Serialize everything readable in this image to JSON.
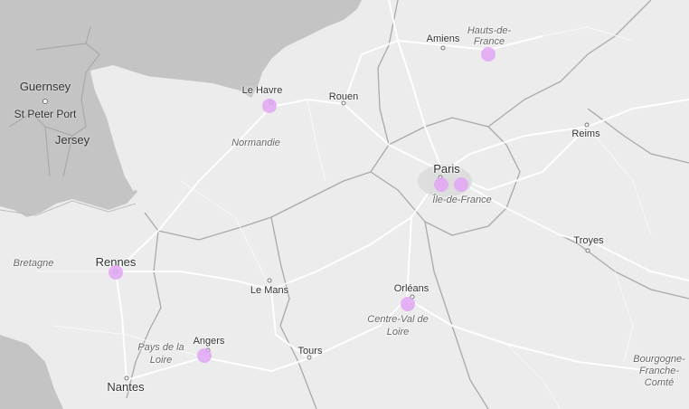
{
  "map": {
    "colors": {
      "sea": "#c4c4c4",
      "land": "#ececec",
      "road": "#ffffff",
      "border": "#a9a9a9",
      "marker": "#e2a6f5"
    },
    "islands": [
      "Guernsey",
      "St Peter Port",
      "Jersey"
    ],
    "cities": {
      "amiens": "Amiens",
      "le_havre": "Le Havre",
      "rouen": "Rouen",
      "paris": "Paris",
      "reims": "Reims",
      "troyes": "Troyes",
      "rennes": "Rennes",
      "le_mans": "Le Mans",
      "orleans": "Orléans",
      "angers": "Angers",
      "tours": "Tours",
      "nantes": "Nantes"
    },
    "regions": {
      "hauts_de_france_1": "Hauts-de-",
      "hauts_de_france_2": "France",
      "normandie": "Normandie",
      "ile_de_france": "Île-de-France",
      "bretagne": "Bretagne",
      "pays_de_la_loire_1": "Pays de la",
      "pays_de_la_loire_2": "Loire",
      "centre_val_de_loire_1": "Centre-Val de",
      "centre_val_de_loire_2": "Loire",
      "bourgogne_1": "Bourgogne-",
      "bourgogne_2": "Franche-",
      "bourgogne_3": "Comté"
    },
    "markers": [
      {
        "name": "le-havre"
      },
      {
        "name": "hauts-de-france"
      },
      {
        "name": "paris-west"
      },
      {
        "name": "paris-east"
      },
      {
        "name": "rennes"
      },
      {
        "name": "orleans"
      },
      {
        "name": "angers"
      }
    ]
  }
}
